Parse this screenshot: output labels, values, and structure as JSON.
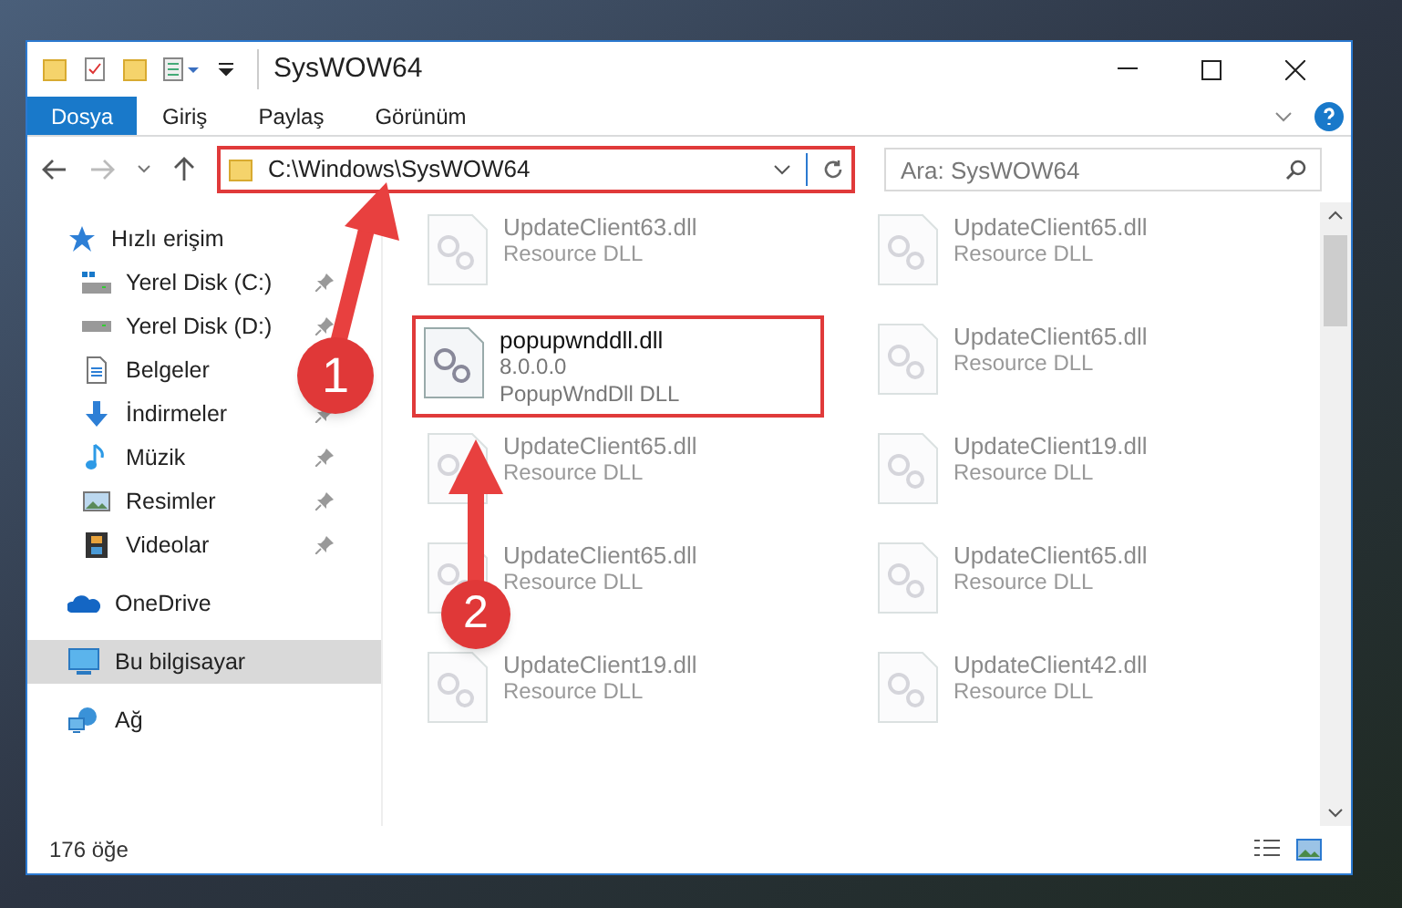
{
  "window": {
    "title": "SysWOW64"
  },
  "ribbon_tabs": [
    {
      "label": "Dosya",
      "selected": true
    },
    {
      "label": "Giriş",
      "selected": false
    },
    {
      "label": "Paylaş",
      "selected": false
    },
    {
      "label": "Görünüm",
      "selected": false
    }
  ],
  "address_bar": {
    "path": "C:\\Windows\\SysWOW64"
  },
  "search": {
    "placeholder": "Ara: SysWOW64"
  },
  "sidebar": {
    "items": [
      {
        "label": "Hızlı erişim",
        "selected": false,
        "children": [
          {
            "label": "Yerel Disk (C:)",
            "pinned": true
          },
          {
            "label": "Yerel Disk (D:)",
            "pinned": true
          },
          {
            "label": "Belgeler",
            "pinned": false
          },
          {
            "label": "İndirmeler",
            "pinned": true
          },
          {
            "label": "Müzik",
            "pinned": true
          },
          {
            "label": "Resimler",
            "pinned": true
          },
          {
            "label": "Videolar",
            "pinned": true
          }
        ]
      },
      {
        "label": "OneDrive",
        "selected": false
      },
      {
        "label": "Bu bilgisayar",
        "selected": true
      },
      {
        "label": "Ağ",
        "selected": false
      }
    ]
  },
  "files": [
    {
      "name": "UpdateClient63.dll",
      "lines": [
        "Resource DLL"
      ],
      "dimmed": true
    },
    {
      "name": "UpdateClient65.dll",
      "lines": [
        "Resource DLL"
      ],
      "dimmed": true
    },
    {
      "name": "popupwnddll.dll",
      "lines": [
        "8.0.0.0",
        "PopupWndDll DLL"
      ],
      "dimmed": false
    },
    {
      "name": "UpdateClient65.dll",
      "lines": [
        "Resource DLL"
      ],
      "dimmed": true
    },
    {
      "name": "UpdateClient65.dll",
      "lines": [
        "Resource DLL"
      ],
      "dimmed": true
    },
    {
      "name": "UpdateClient19.dll",
      "lines": [
        "Resource DLL"
      ],
      "dimmed": true
    },
    {
      "name": "UpdateClient65.dll",
      "lines": [
        "Resource DLL"
      ],
      "dimmed": true
    },
    {
      "name": "UpdateClient65.dll",
      "lines": [
        "Resource DLL"
      ],
      "dimmed": true
    },
    {
      "name": "UpdateClient19.dll",
      "lines": [
        "Resource DLL"
      ],
      "dimmed": true
    },
    {
      "name": "UpdateClient42.dll",
      "lines": [
        "Resource DLL"
      ],
      "dimmed": true
    }
  ],
  "status_bar": {
    "count": "176 öğe"
  },
  "annotations": [
    {
      "label": "1"
    },
    {
      "label": "2"
    }
  ]
}
